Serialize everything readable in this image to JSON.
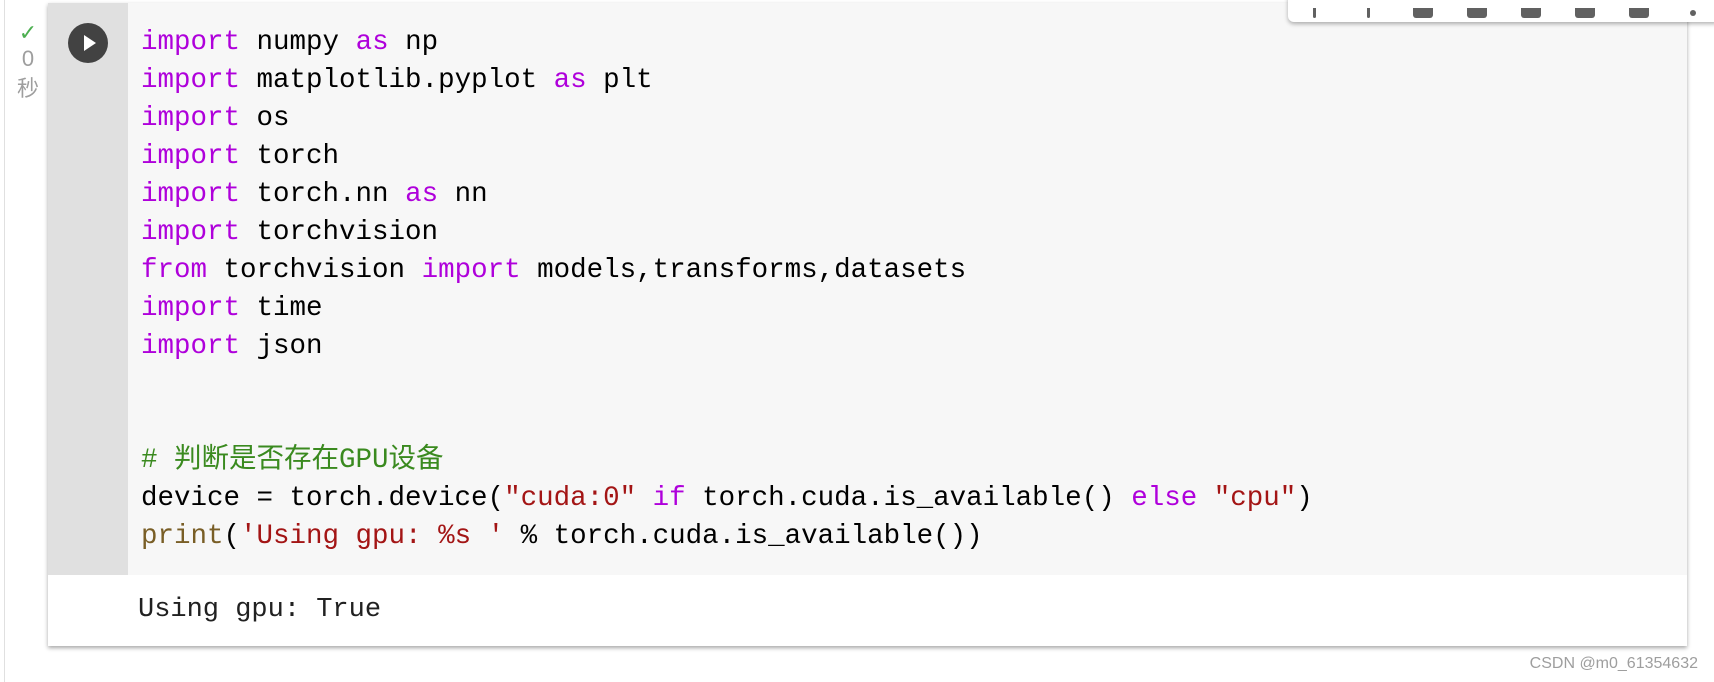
{
  "status": {
    "check_icon": "checkmark-icon",
    "duration": "0",
    "unit": "秒"
  },
  "toolbar": {
    "icons": [
      "arrow-up-icon",
      "arrow-down-icon",
      "link-icon",
      "comment-icon",
      "gear-icon",
      "mirror-cell-icon",
      "delete-icon",
      "more-vert-icon"
    ]
  },
  "code": {
    "lines": [
      [
        [
          "kw",
          "import"
        ],
        [
          "t",
          " numpy "
        ],
        [
          "kw",
          "as"
        ],
        [
          "t",
          " np"
        ]
      ],
      [
        [
          "kw",
          "import"
        ],
        [
          "t",
          " matplotlib.pyplot "
        ],
        [
          "kw",
          "as"
        ],
        [
          "t",
          " plt"
        ]
      ],
      [
        [
          "kw",
          "import"
        ],
        [
          "t",
          " os"
        ]
      ],
      [
        [
          "kw",
          "import"
        ],
        [
          "t",
          " torch"
        ]
      ],
      [
        [
          "kw",
          "import"
        ],
        [
          "t",
          " torch.nn "
        ],
        [
          "kw",
          "as"
        ],
        [
          "t",
          " nn"
        ]
      ],
      [
        [
          "kw",
          "import"
        ],
        [
          "t",
          " torchvision"
        ]
      ],
      [
        [
          "kw",
          "from"
        ],
        [
          "t",
          " torchvision "
        ],
        [
          "kw",
          "import"
        ],
        [
          "t",
          " models,transforms,datasets"
        ]
      ],
      [
        [
          "kw",
          "import"
        ],
        [
          "t",
          " time"
        ]
      ],
      [
        [
          "kw",
          "import"
        ],
        [
          "t",
          " json"
        ]
      ],
      [],
      [],
      [
        [
          "cm",
          "# 判断是否存在GPU设备"
        ]
      ],
      [
        [
          "t",
          "device = torch.device("
        ],
        [
          "str",
          "\"cuda:0\""
        ],
        [
          "t",
          " "
        ],
        [
          "kw",
          "if"
        ],
        [
          "t",
          " torch.cuda.is_available() "
        ],
        [
          "kw",
          "else"
        ],
        [
          "t",
          " "
        ],
        [
          "str",
          "\"cpu\""
        ],
        [
          "t",
          ")"
        ]
      ],
      [
        [
          "fn",
          "print"
        ],
        [
          "t",
          "("
        ],
        [
          "str",
          "'Using gpu: %s '"
        ],
        [
          "t",
          " % torch.cuda.is_available())"
        ]
      ]
    ]
  },
  "output": {
    "text": "Using gpu: True"
  },
  "watermark": "CSDN @m0_61354632"
}
